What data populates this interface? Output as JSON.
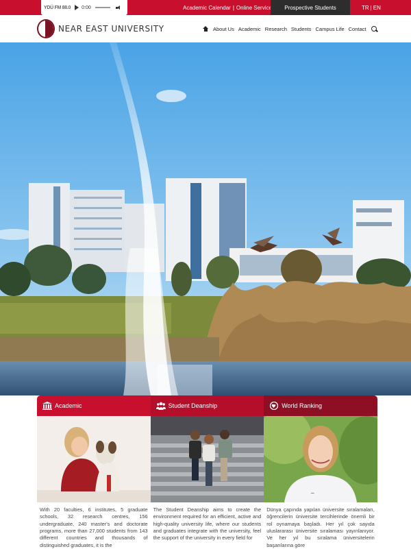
{
  "topbar": {
    "radio_logo": "YDÜ FM 88.0",
    "radio_time": "0:00",
    "links": [
      "Academic Calendar",
      "Online Services"
    ],
    "link_separator": "|",
    "prospective": "Prospective Students",
    "lang": [
      "TR",
      "EN"
    ],
    "lang_separator": "|"
  },
  "header": {
    "brand": "NEAR EAST UNIVERSITY",
    "nav": [
      "About Us",
      "Academic",
      "Research",
      "Students",
      "Campus Life",
      "Contact"
    ]
  },
  "cards": [
    {
      "title": "Academic",
      "text": "With 20 faculties, 6 institutes, 5 graduate schools, 32 research centres, 156 undergraduate, 240 master's and doctorate programs, more than 27,000 students from 143 different countries and thousands of distinguished graduates, it is the"
    },
    {
      "title": "Student Deanship",
      "text": "The Student Deanship aims to create the environment required for an efficient, active and high-quality university life, where our students and graduates integrate with the university, feel the support of the university in every field for"
    },
    {
      "title": "World Ranking",
      "text": "Dünya çapında yapılan üniversite sıralamaları, öğrencilerin üniversite tercihlerinde önemli bir rol oynamaya başladı. Her yıl çok sayıda uluslararası üniversite sıralaması yayınlanıyor. Ve her yıl bu sıralama üniversitelerin başarılarına göre"
    }
  ],
  "colors": {
    "brand_red": "#c8102e",
    "dark_red": "#8e0f24",
    "dark_grey": "#2d2d2d"
  }
}
